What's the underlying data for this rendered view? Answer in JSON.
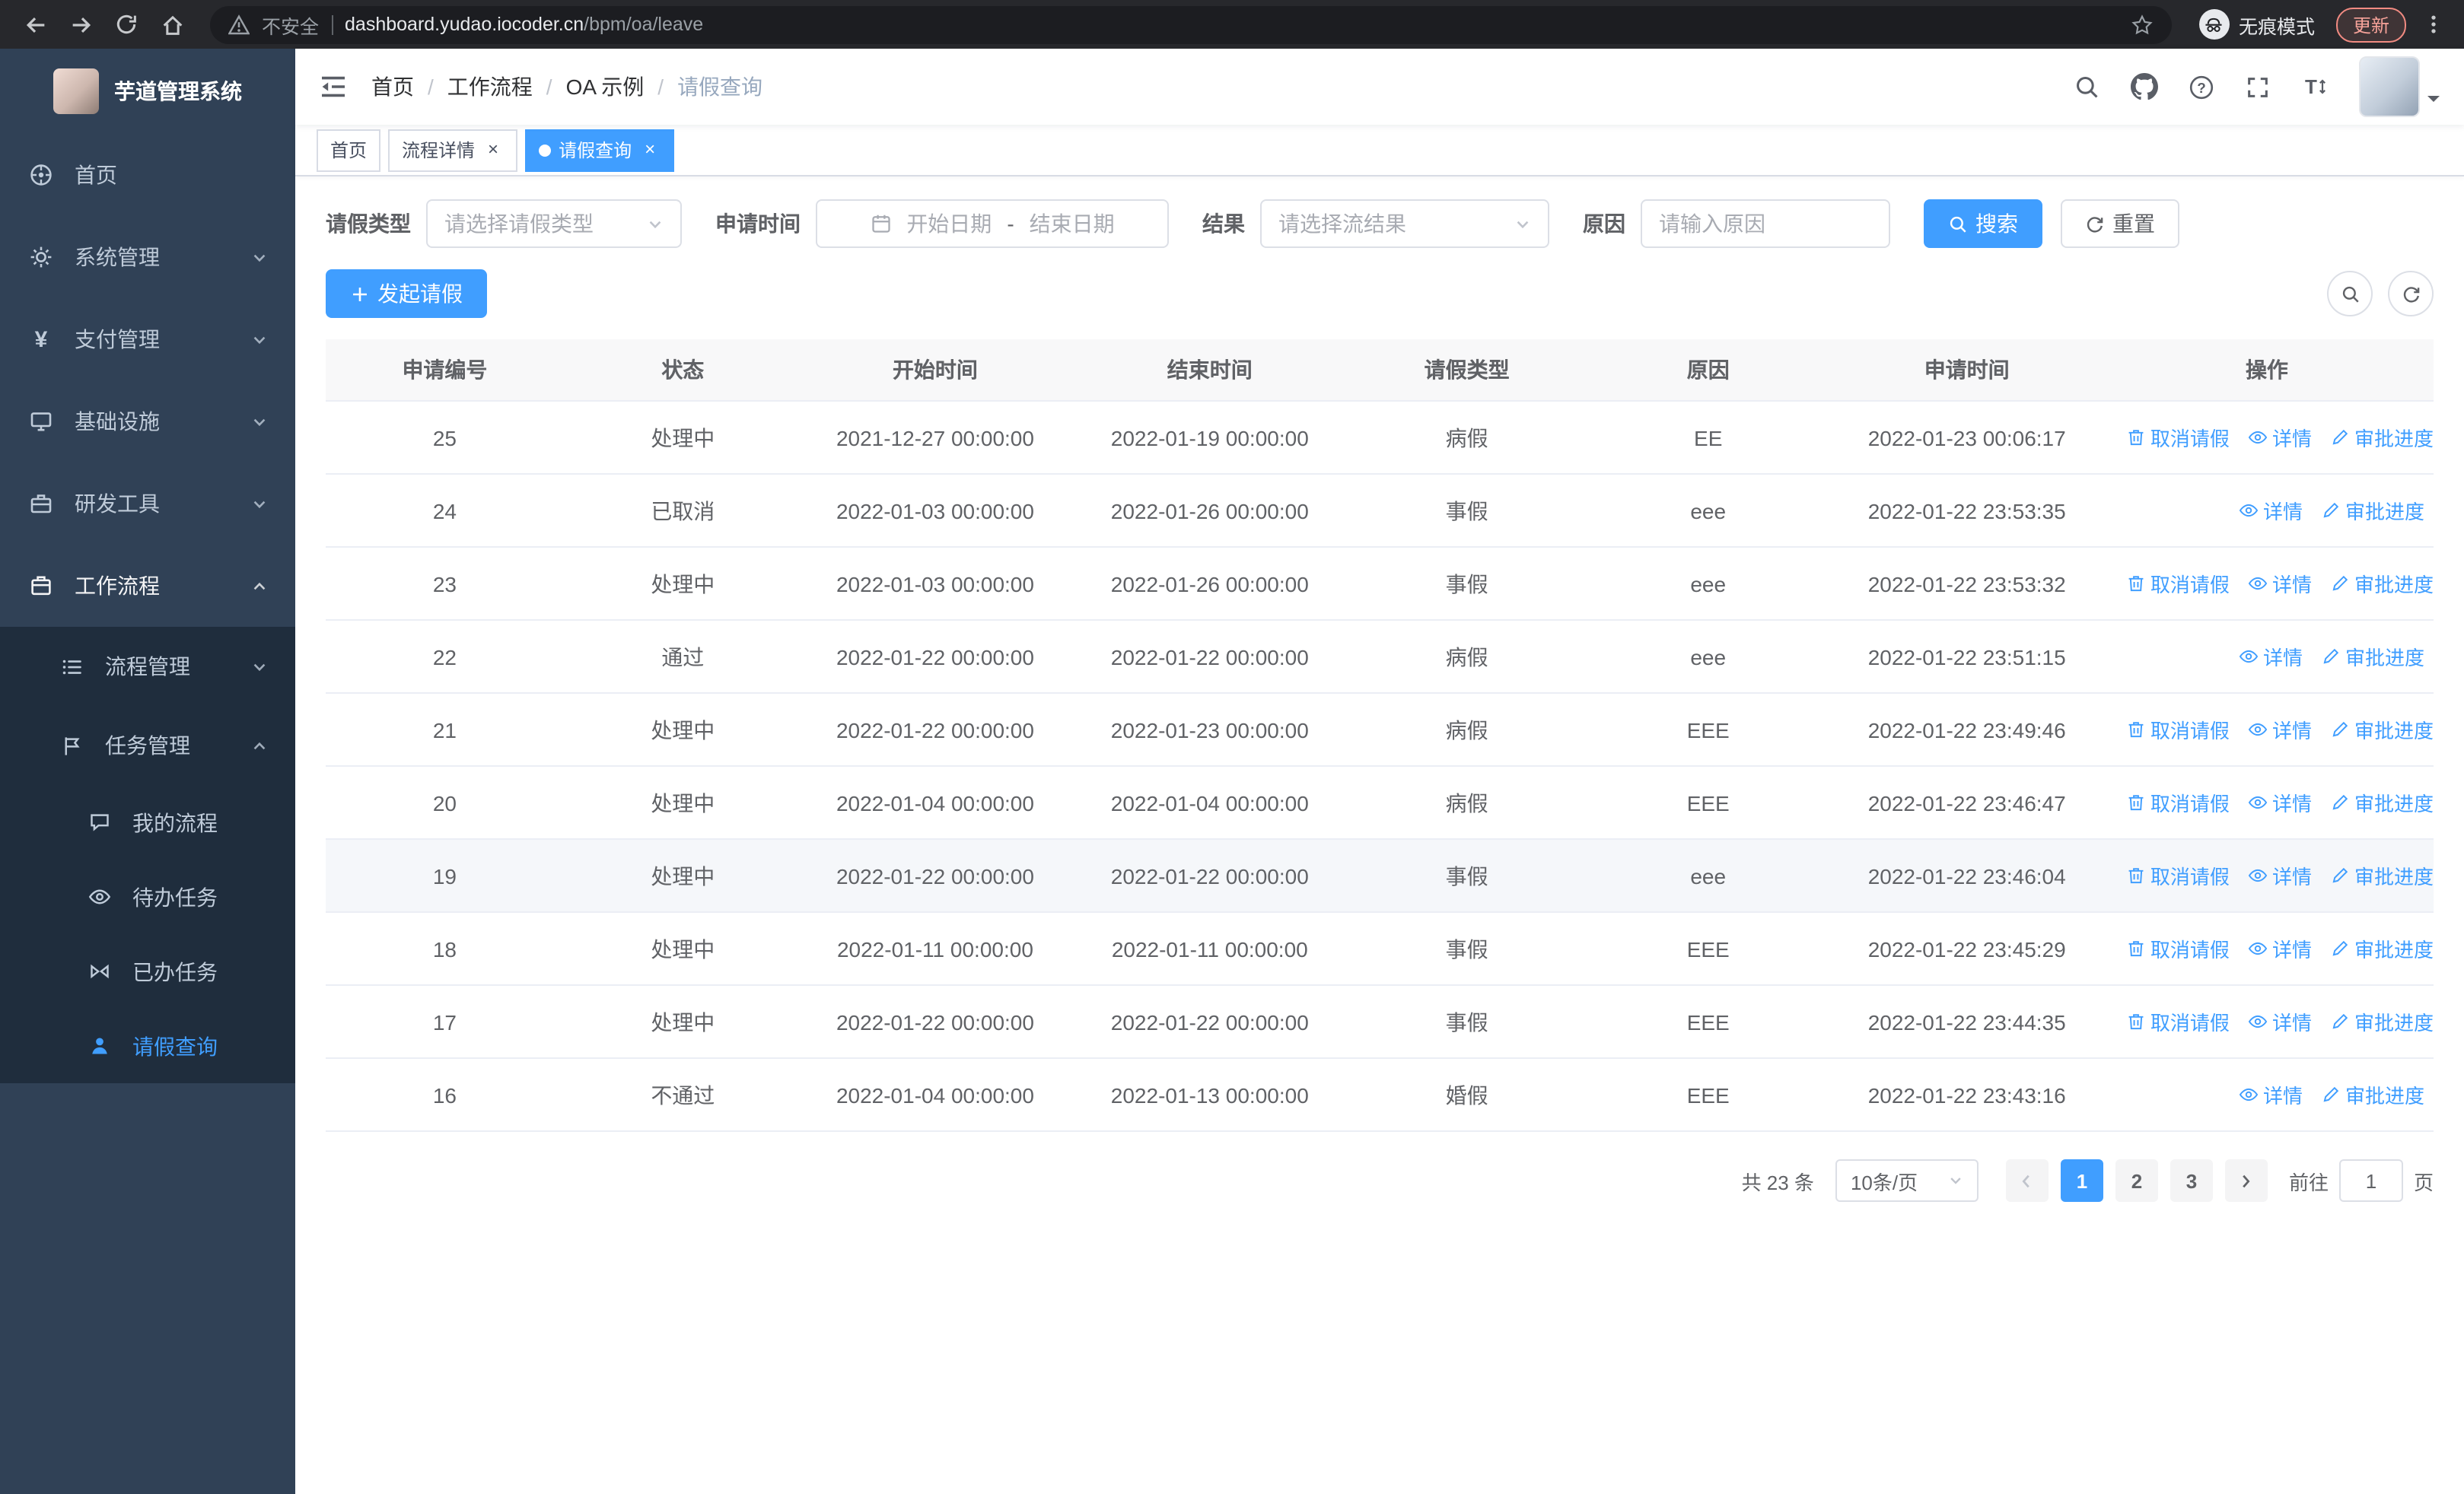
{
  "browser": {
    "security_warning": "不安全",
    "url_host": "dashboard.yudao.iocoder.cn",
    "url_path": "/bpm/oa/leave",
    "incognito_label": "无痕模式",
    "update_button": "更新"
  },
  "sidebar": {
    "logo_title": "芋道管理系统",
    "items": [
      {
        "label": "首页",
        "icon": "dashboard-icon"
      },
      {
        "label": "系统管理",
        "icon": "gear-icon"
      },
      {
        "label": "支付管理",
        "icon": "yen-icon"
      },
      {
        "label": "基础设施",
        "icon": "monitor-icon"
      },
      {
        "label": "研发工具",
        "icon": "toolbox-icon"
      },
      {
        "label": "工作流程",
        "icon": "briefcase-icon"
      }
    ],
    "submenu": [
      {
        "label": "流程管理",
        "icon": "list-icon"
      },
      {
        "label": "任务管理",
        "icon": "flag-icon"
      }
    ],
    "task_items": [
      {
        "label": "我的流程",
        "icon": "chat-icon"
      },
      {
        "label": "待办任务",
        "icon": "eye-icon"
      },
      {
        "label": "已办任务",
        "icon": "bowtie-icon"
      },
      {
        "label": "请假查询",
        "icon": "person-icon"
      }
    ]
  },
  "header": {
    "breadcrumb": [
      "首页",
      "工作流程",
      "OA 示例",
      "请假查询"
    ]
  },
  "tabs": [
    {
      "label": "首页"
    },
    {
      "label": "流程详情"
    },
    {
      "label": "请假查询"
    }
  ],
  "filters": {
    "leave_type_label": "请假类型",
    "leave_type_placeholder": "请选择请假类型",
    "apply_time_label": "申请时间",
    "start_date_placeholder": "开始日期",
    "range_separator": "-",
    "end_date_placeholder": "结束日期",
    "result_label": "结果",
    "result_placeholder": "请选择流结果",
    "reason_label": "原因",
    "reason_placeholder": "请输入原因",
    "search_button": "搜索",
    "reset_button": "重置"
  },
  "toolbar": {
    "create_button": "发起请假"
  },
  "actions": {
    "cancel": "取消请假",
    "detail": "详情",
    "progress": "审批进度"
  },
  "table": {
    "columns": [
      "申请编号",
      "状态",
      "开始时间",
      "结束时间",
      "请假类型",
      "原因",
      "申请时间",
      "操作"
    ],
    "rows": [
      {
        "id": "25",
        "status": "处理中",
        "start": "2021-12-27 00:00:00",
        "end": "2022-01-19 00:00:00",
        "type": "病假",
        "reason": "EE",
        "applyTime": "2022-01-23 00:06:17",
        "actions": [
          "cancel",
          "detail",
          "progress"
        ]
      },
      {
        "id": "24",
        "status": "已取消",
        "start": "2022-01-03 00:00:00",
        "end": "2022-01-26 00:00:00",
        "type": "事假",
        "reason": "eee",
        "applyTime": "2022-01-22 23:53:35",
        "actions": [
          "detail",
          "progress"
        ]
      },
      {
        "id": "23",
        "status": "处理中",
        "start": "2022-01-03 00:00:00",
        "end": "2022-01-26 00:00:00",
        "type": "事假",
        "reason": "eee",
        "applyTime": "2022-01-22 23:53:32",
        "actions": [
          "cancel",
          "detail",
          "progress"
        ]
      },
      {
        "id": "22",
        "status": "通过",
        "start": "2022-01-22 00:00:00",
        "end": "2022-01-22 00:00:00",
        "type": "病假",
        "reason": "eee",
        "applyTime": "2022-01-22 23:51:15",
        "actions": [
          "detail",
          "progress"
        ]
      },
      {
        "id": "21",
        "status": "处理中",
        "start": "2022-01-22 00:00:00",
        "end": "2022-01-23 00:00:00",
        "type": "病假",
        "reason": "EEE",
        "applyTime": "2022-01-22 23:49:46",
        "actions": [
          "cancel",
          "detail",
          "progress"
        ]
      },
      {
        "id": "20",
        "status": "处理中",
        "start": "2022-01-04 00:00:00",
        "end": "2022-01-04 00:00:00",
        "type": "病假",
        "reason": "EEE",
        "applyTime": "2022-01-22 23:46:47",
        "actions": [
          "cancel",
          "detail",
          "progress"
        ]
      },
      {
        "id": "19",
        "status": "处理中",
        "start": "2022-01-22 00:00:00",
        "end": "2022-01-22 00:00:00",
        "type": "事假",
        "reason": "eee",
        "applyTime": "2022-01-22 23:46:04",
        "actions": [
          "cancel",
          "detail",
          "progress"
        ],
        "highlighted": true
      },
      {
        "id": "18",
        "status": "处理中",
        "start": "2022-01-11 00:00:00",
        "end": "2022-01-11 00:00:00",
        "type": "事假",
        "reason": "EEE",
        "applyTime": "2022-01-22 23:45:29",
        "actions": [
          "cancel",
          "detail",
          "progress"
        ]
      },
      {
        "id": "17",
        "status": "处理中",
        "start": "2022-01-22 00:00:00",
        "end": "2022-01-22 00:00:00",
        "type": "事假",
        "reason": "EEE",
        "applyTime": "2022-01-22 23:44:35",
        "actions": [
          "cancel",
          "detail",
          "progress"
        ]
      },
      {
        "id": "16",
        "status": "不通过",
        "start": "2022-01-04 00:00:00",
        "end": "2022-01-13 00:00:00",
        "type": "婚假",
        "reason": "EEE",
        "applyTime": "2022-01-22 23:43:16",
        "actions": [
          "detail",
          "progress"
        ]
      }
    ]
  },
  "pagination": {
    "total_label": "共 23 条",
    "page_size_label": "10条/页",
    "pages": [
      {
        "label": "1",
        "active": true
      },
      {
        "label": "2"
      },
      {
        "label": "3"
      }
    ],
    "goto_label": "前往",
    "goto_value": "1",
    "goto_suffix": "页"
  },
  "colors": {
    "primary": "#409eff",
    "sidebar_bg": "#304156",
    "submenu_bg": "#1f2d3d",
    "active_tab_bg": "#409eff"
  }
}
